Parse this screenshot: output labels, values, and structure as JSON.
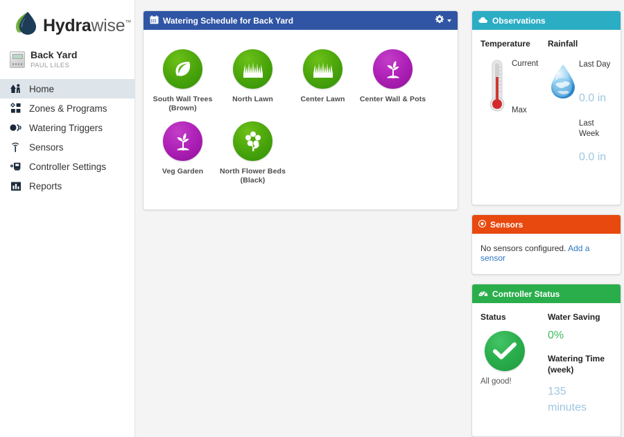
{
  "brand": {
    "name_bold": "Hydra",
    "name_light": "wise",
    "trademark": "™",
    "logo_icon": "water-drop-leaf-logo",
    "colors": {
      "drop": "#1b3a54",
      "leaf": "#6aab3e"
    }
  },
  "controller": {
    "name": "Back Yard",
    "user": "PAUL LILES",
    "thumb_icon": "controller-device-thumbnail"
  },
  "sidebar": {
    "items": [
      {
        "label": "Home",
        "icon": "home-icon",
        "active": true
      },
      {
        "label": "Zones & Programs",
        "icon": "zones-grid-icon",
        "active": false
      },
      {
        "label": "Watering Triggers",
        "icon": "watering-triggers-icon",
        "active": false
      },
      {
        "label": "Sensors",
        "icon": "sensor-antenna-icon",
        "active": false
      },
      {
        "label": "Controller Settings",
        "icon": "controller-settings-icon",
        "active": false
      },
      {
        "label": "Reports",
        "icon": "reports-bar-chart-icon",
        "active": false
      }
    ],
    "active_bg": "#dde4ea"
  },
  "schedule_panel": {
    "title": "Watering Schedule for Back Yard",
    "header_icon": "calendar-icon",
    "header_color": "#2f55a4",
    "menu_icon": "gear-icon",
    "menu_caret": "chevron-down-icon",
    "zones": [
      {
        "label_line1": "South Wall Trees",
        "label_line2": "(Brown)",
        "icon": "leaf-icon",
        "color": "green"
      },
      {
        "label_line1": "North Lawn",
        "label_line2": "",
        "icon": "grass-icon",
        "color": "green"
      },
      {
        "label_line1": "Center Lawn",
        "label_line2": "",
        "icon": "grass-icon",
        "color": "green"
      },
      {
        "label_line1": "Center Wall & Pots",
        "label_line2": "",
        "icon": "seedling-icon",
        "color": "purple"
      },
      {
        "label_line1": "Veg Garden",
        "label_line2": "",
        "icon": "seedling-icon",
        "color": "purple"
      },
      {
        "label_line1": "North Flower Beds",
        "label_line2": "(Black)",
        "icon": "flower-icon",
        "color": "green"
      }
    ]
  },
  "observations_panel": {
    "title": "Observations",
    "header_icon": "cloud-icon",
    "header_color": "#2badc4",
    "temperature": {
      "heading": "Temperature",
      "icon": "thermometer-icon",
      "current_label": "Current",
      "current_value": "",
      "max_label": "Max",
      "max_value": ""
    },
    "rainfall": {
      "heading": "Rainfall",
      "icon": "water-drop-globe-icon",
      "last_day_label": "Last Day",
      "last_day_value": "0.0 in",
      "last_week_label": "Last Week",
      "last_week_value": "0.0 in"
    }
  },
  "sensors_panel": {
    "title": "Sensors",
    "header_icon": "sensor-target-icon",
    "header_color": "#e8490f",
    "empty_text": "No sensors configured.",
    "link_text": "Add a sensor"
  },
  "controller_status_panel": {
    "title": "Controller Status",
    "header_icon": "dashboard-gauge-icon",
    "header_color": "#2aae4c",
    "status_heading": "Status",
    "status_icon": "check-circle-icon",
    "status_text": "All good!",
    "water_saving_heading": "Water Saving",
    "water_saving_value": "0%",
    "water_saving_color": "#3fbb5f",
    "watering_time_heading": "Watering Time (week)",
    "watering_time_value": "135 minutes",
    "watering_time_color": "#9ec6e0"
  }
}
